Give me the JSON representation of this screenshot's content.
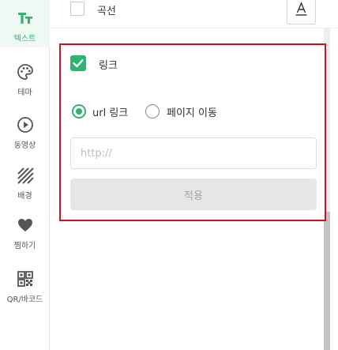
{
  "sidebar": {
    "items": [
      {
        "label": "텍스트",
        "icon": "text-icon",
        "active": true
      },
      {
        "label": "테마",
        "icon": "palette-icon",
        "active": false
      },
      {
        "label": "동영상",
        "icon": "play-circle-icon",
        "active": false
      },
      {
        "label": "배경",
        "icon": "diagonal-lines-icon",
        "active": false
      },
      {
        "label": "찜하기",
        "icon": "heart-icon",
        "active": false
      },
      {
        "label": "QR/바코드",
        "icon": "qr-code-icon",
        "active": false
      }
    ]
  },
  "options": {
    "curve": {
      "label": "곡선",
      "checked": false
    },
    "format_icon": "text-underline-icon"
  },
  "link_panel": {
    "checkbox_label": "링크",
    "checked": true,
    "radio_url_label": "url 링크",
    "radio_page_label": "페이지 이동",
    "selected": "url",
    "url_input": {
      "value": "",
      "placeholder": "http://"
    },
    "apply_label": "적용"
  },
  "colors": {
    "accent": "#2fb36e",
    "highlight_border": "#d3101e",
    "disabled_button": "#e6e6e6"
  }
}
